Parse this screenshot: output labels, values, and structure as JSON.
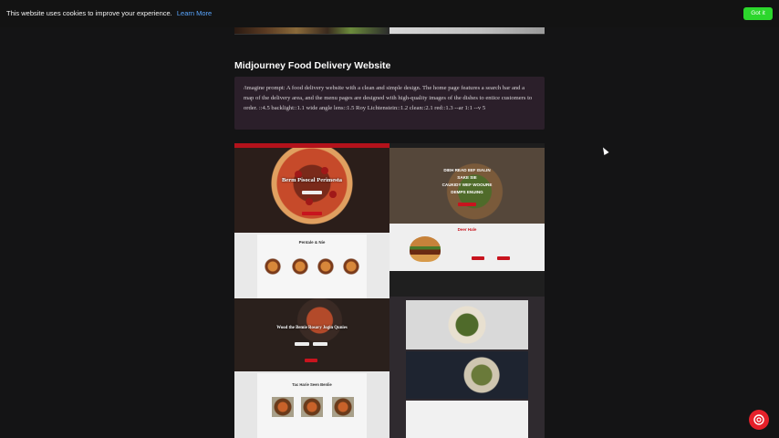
{
  "cookie_bar": {
    "message": "This website uses cookies to improve your experience.",
    "learn_more": "Learn More",
    "accept_label": "Got it"
  },
  "article": {
    "section_title": "Midjourney Food Delivery Website",
    "prompt": "/imagine prompt: A food delivery website with a clean and simple design. The home page features a search bar and a map of the delivery area, and the menu pages are designed with high-quality images of the dishes to entice customers to order. ::4.5 backlight::1.1 wide angle lens::1.5 Roy Lichtenstein::1.2 clean::2.1 red::1.3 --ar 1:1 --v 5"
  },
  "mockups": {
    "pizza_hero_title": "Berm Pisocal Perimesta",
    "salad_hero_lines": [
      "DIEH READ IIEF ISALIN",
      "SAKE SIE",
      "CAUKIDY WEF WOOURE",
      "DEMPS ENUING"
    ],
    "pizza_menu_title": "Pentale & Nie",
    "burger_section_title": "Deer Hale",
    "pasta_hero_title": "Wood the Bemie Rosary Jogin Qunies",
    "bottom_section_title": "Tac Harie Seen Benlie"
  },
  "colors": {
    "accent_red": "#c8141e",
    "cookie_button": "#2cd72c",
    "link": "#5aa6ff",
    "prompt_bg": "#2b1f2a"
  }
}
